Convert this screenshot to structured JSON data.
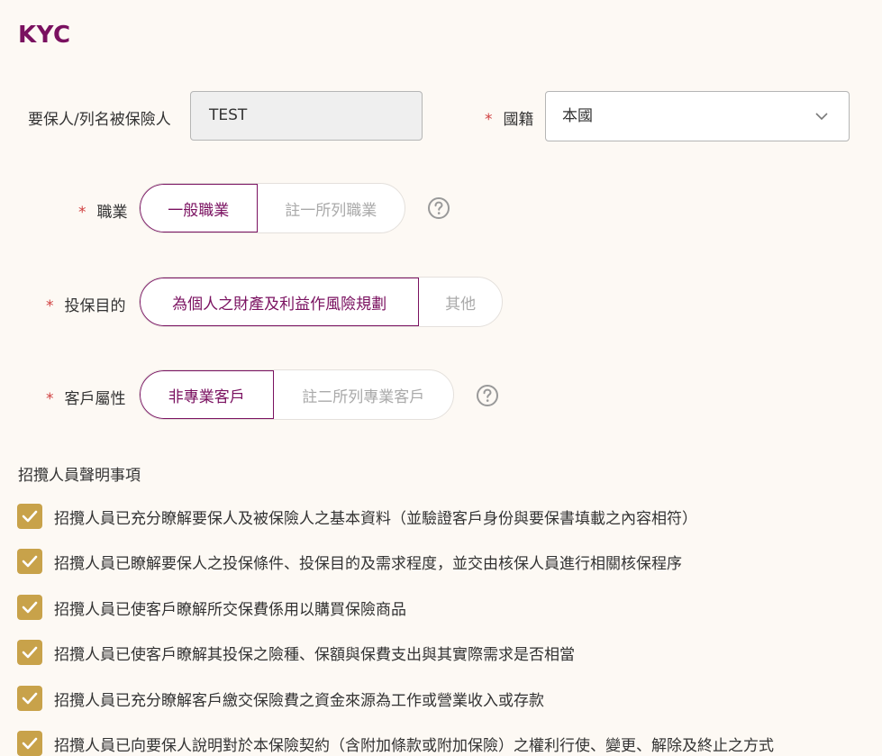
{
  "page_title": "KYC",
  "applicant": {
    "label": "要保人/列名被保險人",
    "value": "TEST"
  },
  "nationality": {
    "label": "國籍",
    "value": "本國",
    "icon": "chevron-down-icon"
  },
  "occupation": {
    "label": "職業",
    "options": [
      "一般職業",
      "註一所列職業"
    ],
    "selected": "一般職業",
    "help_icon": "question-circle-icon"
  },
  "purpose": {
    "label": "投保目的",
    "options": [
      "為個人之財產及利益作風險規劃",
      "其他"
    ],
    "selected": "為個人之財產及利益作風險規劃"
  },
  "customer_type": {
    "label": "客戶屬性",
    "options": [
      "非專業客戶",
      "註二所列專業客戶"
    ],
    "selected": "非專業客戶",
    "help_icon": "question-circle-icon"
  },
  "declarations": {
    "title": "招攬人員聲明事項",
    "items": [
      "招攬人員已充分瞭解要保人及被保險人之基本資料（並驗證客戶身份與要保書填載之內容相符）",
      "招攬人員已瞭解要保人之投保條件、投保目的及需求程度，並交由核保人員進行相關核保程序",
      "招攬人員已使客戶瞭解所交保費係用以購買保險商品",
      "招攬人員已使客戶瞭解其投保之險種、保額與保費支出與其實際需求是否相當",
      "招攬人員已充分瞭解客戶繳交保險費之資金來源為工作或營業收入或存款",
      "招攬人員已向要保人說明對於本保險契約（含附加條款或附加保險）之權利行使、變更、解除及終止之方式"
    ],
    "checked": [
      true,
      true,
      true,
      true,
      true,
      true
    ]
  },
  "colors": {
    "accent": "#7a1160",
    "checkbox": "#c8a24a",
    "required": "#d04040",
    "background": "#fdf9f4"
  }
}
